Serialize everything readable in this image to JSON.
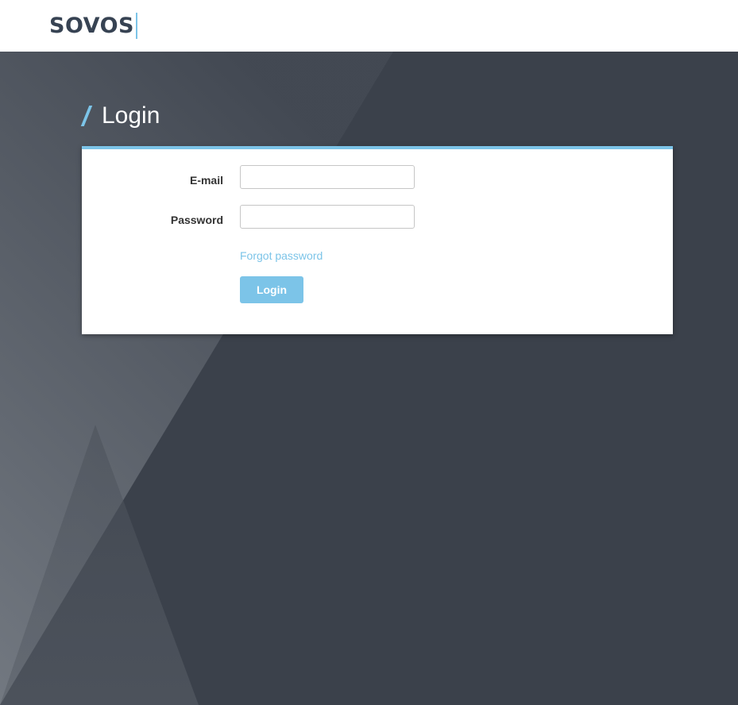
{
  "header": {
    "logo_text": "SOVOS"
  },
  "page": {
    "title": "Login"
  },
  "form": {
    "email_label": "E-mail",
    "email_value": "",
    "email_placeholder": "",
    "password_label": "Password",
    "password_value": "",
    "password_placeholder": "",
    "forgot_label": "Forgot password",
    "login_label": "Login"
  },
  "colors": {
    "accent": "#7cc4e8",
    "background": "#3b414b",
    "logo": "#374353",
    "card": "#ffffff"
  },
  "icons": {
    "title_icon": "slash-accent-icon",
    "logo_divider": "logo-divider"
  }
}
